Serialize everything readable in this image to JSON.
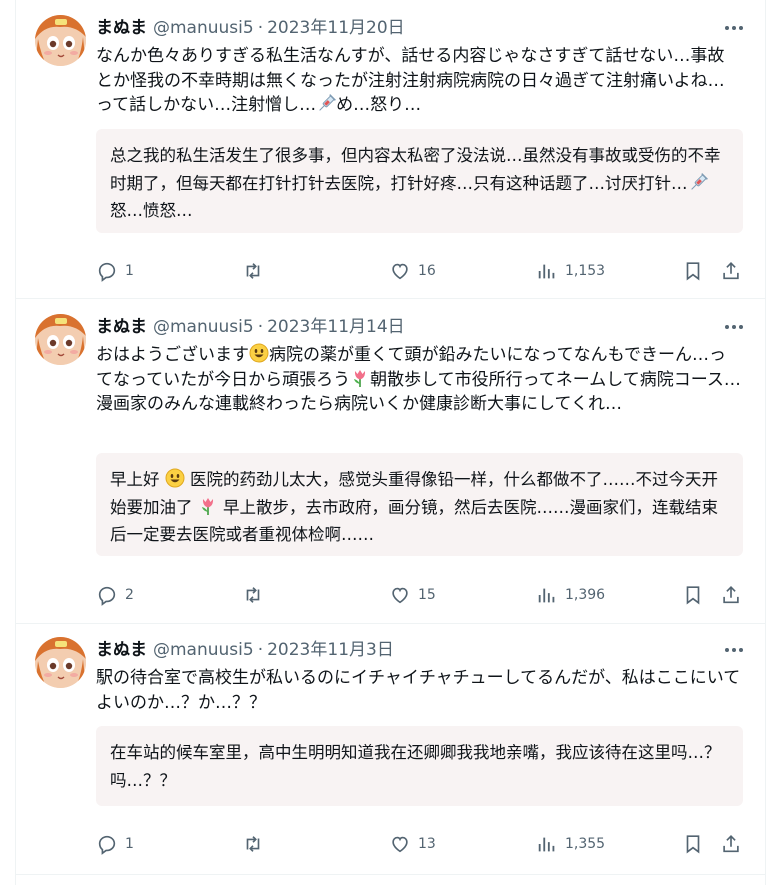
{
  "tweets": [
    {
      "name": "まぬま",
      "handle": "@manuusi5",
      "separator": "·",
      "date": "2023年11月20日",
      "text": [
        "なんか色々ありすぎる私生活なんすが、話せる内容じゃなさすぎて話せない…事故とか怪我の不幸時期は無くなったが注射注射病院病院の日々過ぎて注射痛いよね…って話しかない…注射憎し…",
        "め…怒り…"
      ],
      "emoji": "syringe-icon",
      "translation": [
        "总之我的私生活发生了很多事，但内容太私密了没法说…虽然没有事故或受伤的不幸时期了，但每天都在打针打针去医院，打针好疼…只有这种话题了…讨厌打针…",
        " 怒…愤怒…"
      ],
      "replies": "1",
      "likes": "16",
      "views": "1,153"
    },
    {
      "name": "まぬま",
      "handle": "@manuusi5",
      "separator": "·",
      "date": "2023年11月14日",
      "text": [
        "おはようございます",
        "病院の薬が重くて頭が鉛みたいになってなんもできーん…ってなっていたが今日から頑張ろう",
        "朝散歩して市役所行ってネームして病院コース…漫画家のみんな連載終わったら病院いくか健康診断大事にしてくれ…"
      ],
      "translation": [
        "早上好 ",
        " 医院的药劲儿太大，感觉头重得像铅一样，什么都做不了……不过今天开始要加油了 ",
        " 早上散步，去市政府，画分镜，然后去医院……漫画家们，连载结束后一定要去医院或者重视体检啊……"
      ],
      "replies": "2",
      "likes": "15",
      "views": "1,396"
    },
    {
      "name": "まぬま",
      "handle": "@manuusi5",
      "separator": "·",
      "date": "2023年11月3日",
      "text": [
        "駅の待合室で高校生が私いるのにイチャイチャチューしてるんだが、私はここにいてよいのか…？か…？？"
      ],
      "translation": [
        "在车站的候车室里，高中生明明知道我在还卿卿我我地亲嘴，我应该待在这里吗…？ 吗…？？"
      ],
      "replies": "1",
      "likes": "13",
      "views": "1,355"
    }
  ],
  "colors": {
    "text": "#0f1419",
    "secondary": "#536471",
    "translation_bg": "#f8f3f3",
    "divider": "#eff3f4"
  },
  "icons": [
    "avatar",
    "more-icon",
    "reply-icon",
    "retweet-icon",
    "like-icon",
    "views-icon",
    "bookmark-icon",
    "share-icon",
    "smile-emoji",
    "tulip-emoji",
    "syringe-icon"
  ]
}
